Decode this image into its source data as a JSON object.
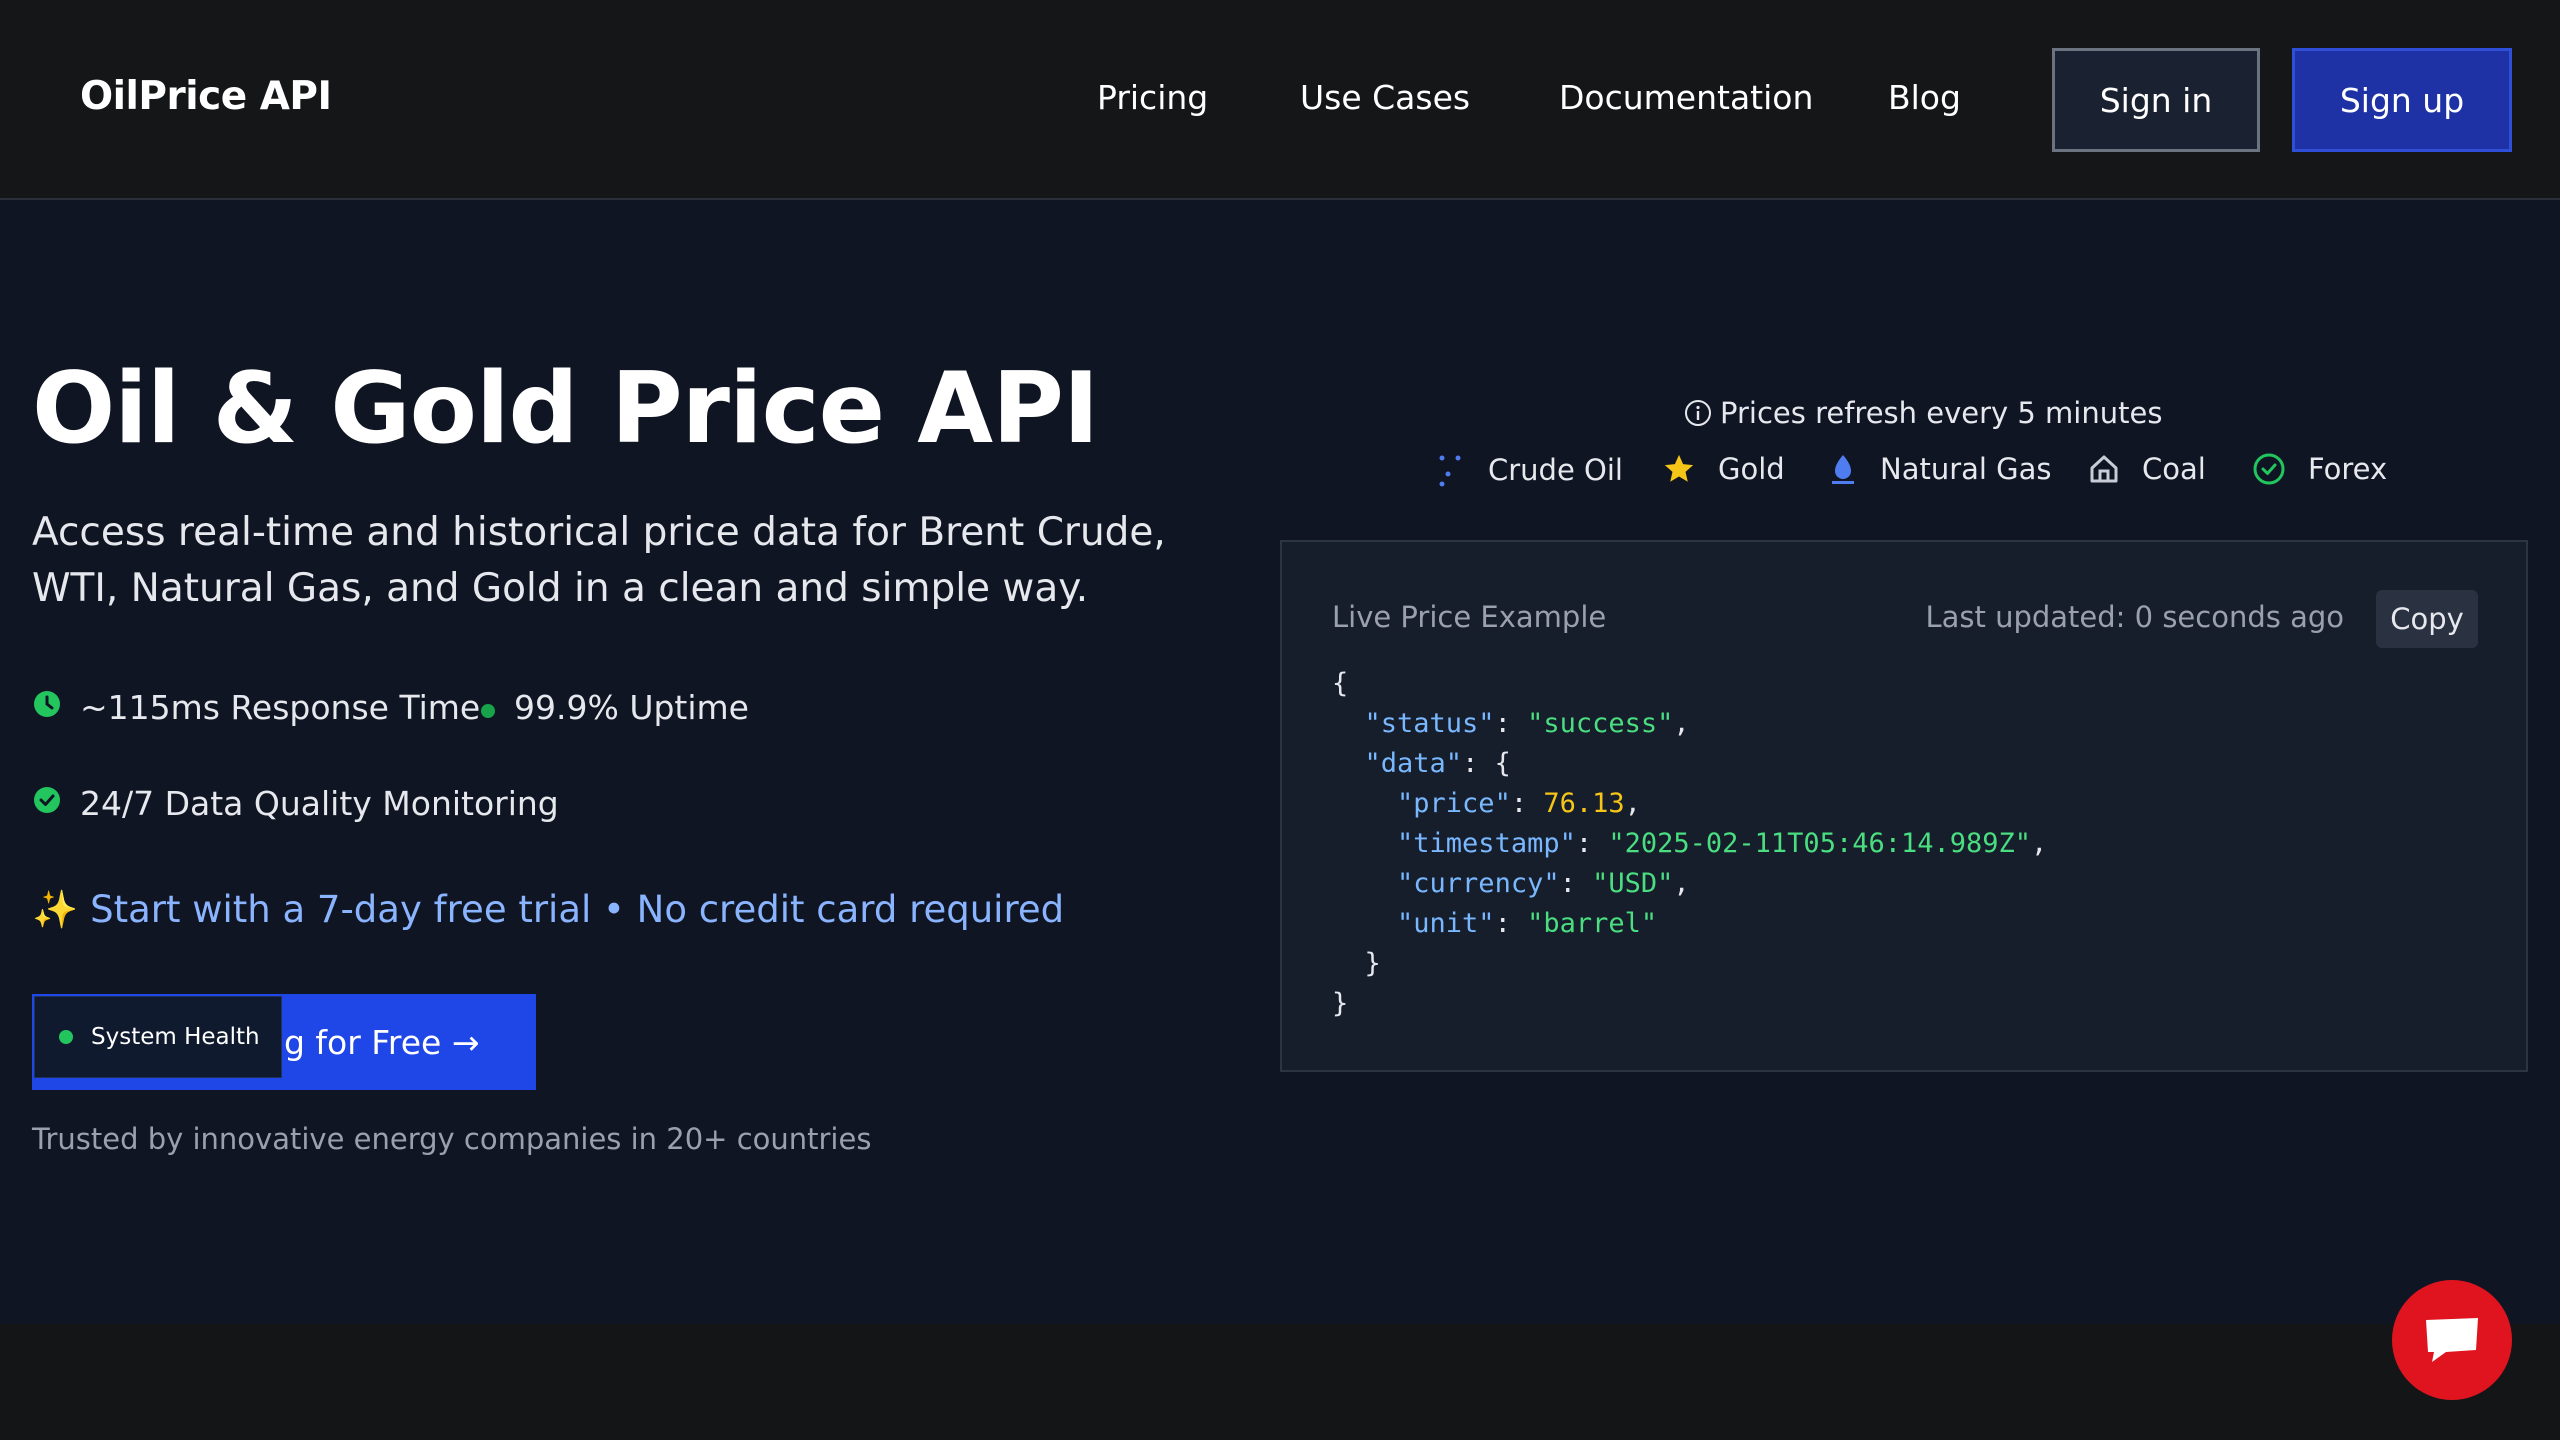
{
  "header": {
    "logo": "OilPrice API",
    "nav": [
      "Pricing",
      "Use Cases",
      "Documentation",
      "Blog"
    ],
    "signin_label": "Sign in",
    "signup_label": "Sign up"
  },
  "hero": {
    "title": "Oil & Gold Price API",
    "description": "Access real-time and historical price data for Brent Crude, WTI, Natural Gas, and Gold in a clean and simple way.",
    "metrics": [
      "~115ms Response Time",
      "99.9% Uptime",
      "24/7 Data Quality Monitoring"
    ],
    "trial_icon": "✨",
    "trial_text": "Start with a 7-day free trial • No credit card required",
    "cta_label": "g for Free →",
    "system_health": "System Health",
    "trusted": "Trusted by innovative energy companies in 20+ countries"
  },
  "prices": {
    "refresh_text": "Prices refresh every 5 minutes",
    "commodities": [
      "Crude Oil",
      "Gold",
      "Natural Gas",
      "Coal",
      "Forex"
    ]
  },
  "live_example": {
    "label": "Live Price Example",
    "updated": "Last updated: 0 seconds ago",
    "copy_label": "Copy",
    "json": {
      "status": "success",
      "price": "76.13",
      "timestamp": "2025-02-11T05:46:14.989Z",
      "currency": "USD",
      "unit": "barrel"
    }
  },
  "colors": {
    "background": "#0f1522",
    "header": "#151618",
    "accent_blue": "#1f46e6",
    "link_blue": "#8ab4ff",
    "success_green": "#22c55e",
    "chat_red": "#e0141e"
  }
}
